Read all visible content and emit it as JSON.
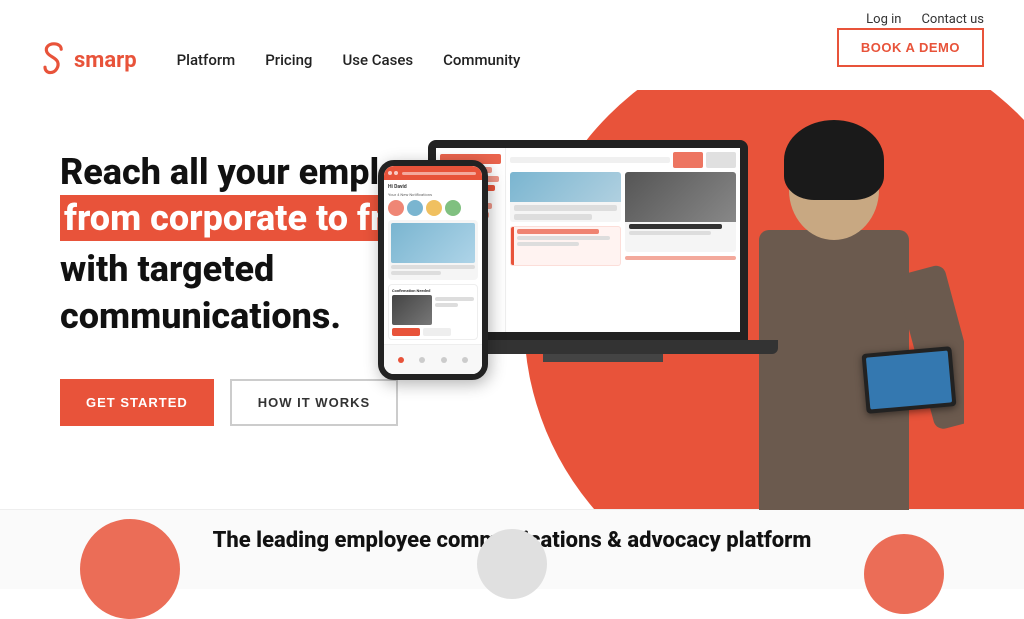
{
  "header": {
    "logo_text": "smarp",
    "top_links": {
      "login": "Log in",
      "contact": "Contact us"
    },
    "nav": {
      "platform": "Platform",
      "pricing": "Pricing",
      "use_cases": "Use Cases",
      "community": "Community"
    },
    "cta_button": "BOOK A DEMO"
  },
  "hero": {
    "headline_line1": "Reach all your employees,",
    "headline_highlight": "from corporate to frontline,",
    "headline_line3": "with targeted communications.",
    "btn_get_started": "GET STARTED",
    "btn_how_it_works": "HOW IT WORKS"
  },
  "footer_section": {
    "tagline": "The leading employee communications & advocacy platform"
  },
  "icons": {
    "smarp_s": "S"
  }
}
